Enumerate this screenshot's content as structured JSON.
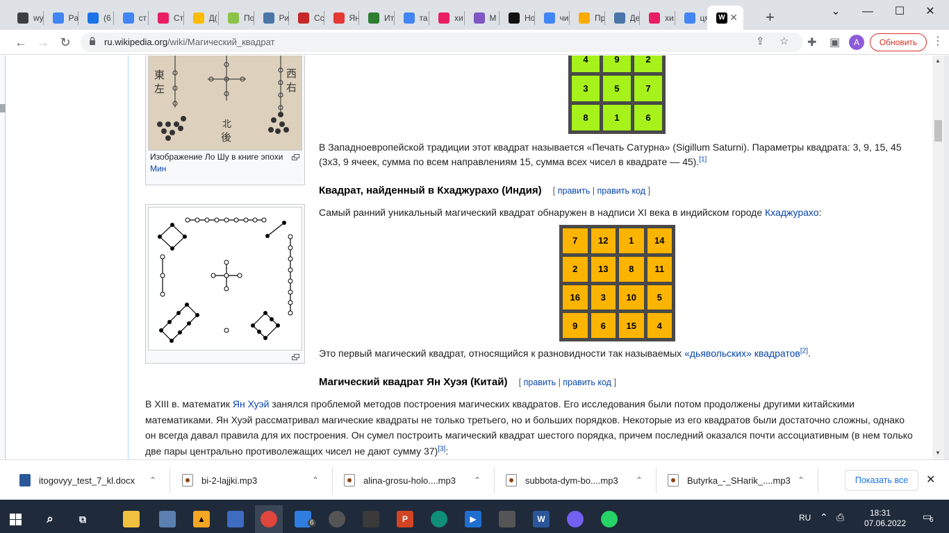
{
  "browser": {
    "tabs": [
      {
        "label": "wy",
        "icon": "bird-icon",
        "color": "#3c4043"
      },
      {
        "label": "Pa",
        "icon": "slash-icon",
        "color": "#4285f4"
      },
      {
        "label": "(6",
        "icon": "mail-icon",
        "color": "#1a73e8"
      },
      {
        "label": "ст",
        "icon": "google-icon",
        "color": "#4285f4"
      },
      {
        "label": "Ст",
        "icon": "flower-icon",
        "color": "#e91e63"
      },
      {
        "label": "Д(",
        "icon": "drive-icon",
        "color": "#fbbc04"
      },
      {
        "label": "По",
        "icon": "music-icon",
        "color": "#8bc34a"
      },
      {
        "label": "Ри",
        "icon": "vk-icon",
        "color": "#4a76a8"
      },
      {
        "label": "Сс",
        "icon": "bookmark-icon",
        "color": "#c62828"
      },
      {
        "label": "Ян",
        "icon": "map-pin-icon",
        "color": "#e53935"
      },
      {
        "label": "Ит",
        "icon": "check-icon",
        "color": "#2e7d32"
      },
      {
        "label": "та",
        "icon": "google-icon",
        "color": "#4285f4"
      },
      {
        "label": "хи",
        "icon": "spiral-icon",
        "color": "#e91e63"
      },
      {
        "label": "М",
        "icon": "map-icon",
        "color": "#7e57c2"
      },
      {
        "label": "Но",
        "icon": "t-icon",
        "color": "#111111"
      },
      {
        "label": "чи",
        "icon": "google-icon",
        "color": "#4285f4"
      },
      {
        "label": "Пр",
        "icon": "slides-icon",
        "color": "#f9ab00"
      },
      {
        "label": "Де",
        "icon": "paw-icon",
        "color": "#4a76a8"
      },
      {
        "label": "хи",
        "icon": "spiral-icon",
        "color": "#e91e63"
      },
      {
        "label": "ця",
        "icon": "google-icon",
        "color": "#4285f4"
      },
      {
        "label": "W",
        "icon": "wikipedia-icon",
        "color": "#000000"
      }
    ],
    "active_tab_index": 20,
    "url_host": "ru.wikipedia.org",
    "url_path": "/wiki/Магический_квадрат",
    "avatar_letter": "A",
    "update_label": "Обновить"
  },
  "article": {
    "caption_lo_shu": "Изображение Ло Шу в книге эпохи",
    "caption_lo_shu_link": "Мин",
    "lo_shu_chars": [
      "東",
      "左",
      "西",
      "右",
      "北",
      "後"
    ],
    "saturn_square": [
      [
        4,
        9,
        2
      ],
      [
        3,
        5,
        7
      ],
      [
        8,
        1,
        6
      ]
    ],
    "saturn_color": "#a6f21a",
    "saturn_text": "В Западноевропейской традиции этот квадрат называется «Печать Сатурна» (Sigillum Saturni). Параметры квадрата: 3, 9, 15, 45",
    "saturn_text2": "(3х3, 9 ячеек, сумма по всем направлениям 15, сумма всех чисел в квадрате — 45).",
    "saturn_ref": "[1]",
    "h_khaj": "Квадрат, найденный в Кхаджурахо (Индия)",
    "edit_bracket_open": "[",
    "edit_link": "править",
    "edit_sep": "|",
    "edit_code_link": "править код",
    "edit_bracket_close": "]",
    "khaj_text": "Самый ранний уникальный магический квадрат обнаружен в надписи XI века в индийском городе",
    "khaj_link": "Кхаджурахо",
    "khaj_colon": ":",
    "khaj_square": [
      [
        7,
        12,
        1,
        14
      ],
      [
        2,
        13,
        8,
        11
      ],
      [
        16,
        3,
        10,
        5
      ],
      [
        9,
        6,
        15,
        4
      ]
    ],
    "khaj_color": "#fbb400",
    "devil_text": "Это первый магический квадрат, относящийся к разновидности так называемых",
    "devil_link": "«дьявольских» квадратов",
    "devil_ref": "[2]",
    "devil_dot": ".",
    "h_yang": "Магический квадрат Ян Хуэя (Китай)",
    "yang_p1a": "В XIII в. математик",
    "yang_link": "Ян Хуэй",
    "yang_p1b": "занялся проблемой методов построения магических квадратов. Его исследования были потом продолжены другими китайскими",
    "yang_p2": "математиками. Ян Хуэй рассматривал магические квадраты не только третьего, но и больших порядков. Некоторые из его квадратов были достаточно сложны, однако",
    "yang_p3": "он всегда давал правила для их построения. Он сумел построить магический квадрат шестого порядка, причем последний оказался почти ассоциативным (в нем только",
    "yang_p4": "две пары центрально противолежащих чисел не дают сумму 37)",
    "yang_ref": "[3]",
    "yang_colon": ":"
  },
  "downloads": {
    "items": [
      {
        "name": "itogovyy_test_7_kl.docx",
        "type": "docx"
      },
      {
        "name": "bi-2-lajjki.mp3",
        "type": "mp3"
      },
      {
        "name": "alina-grosu-holo....mp3",
        "type": "mp3"
      },
      {
        "name": "subbota-dym-bo....mp3",
        "type": "mp3"
      },
      {
        "name": "Butyrka_-_SHarik_....mp3",
        "type": "mp3"
      }
    ],
    "show_all": "Показать все"
  },
  "taskbar": {
    "lang": "RU",
    "time": "18:31",
    "date": "07.06.2022",
    "notif_count": "6",
    "mail_badge": "6"
  }
}
